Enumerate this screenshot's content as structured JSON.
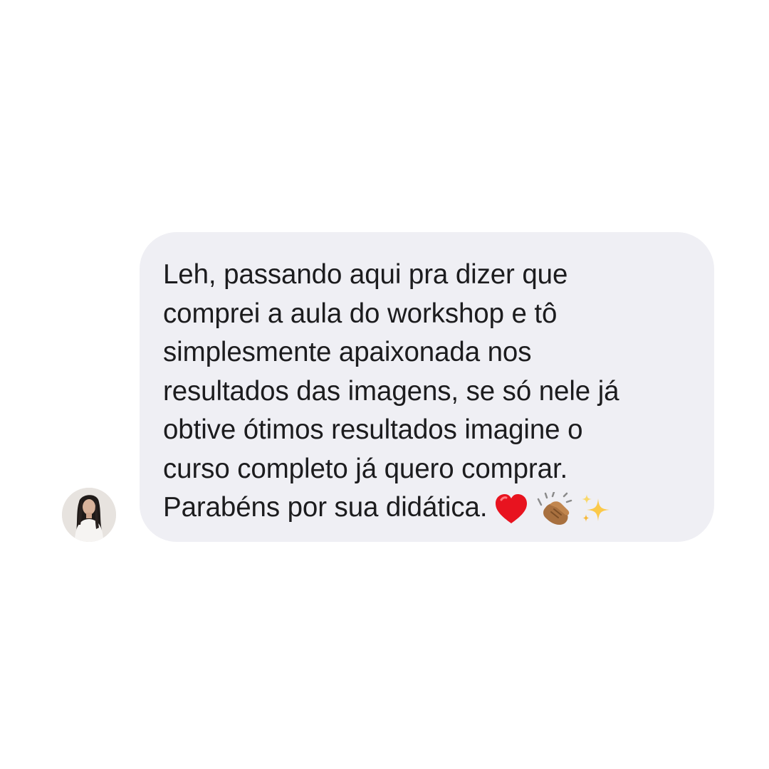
{
  "conversation": {
    "message": {
      "lines": [
        "Leh, passando aqui pra dizer que",
        "comprei a aula do workshop e tô",
        "simplesmente apaixonada nos",
        "resultados das imagens, se só nele já",
        "obtive ótimos resultados imagine o",
        "curso completo já quero comprar.",
        "Parabéns por sua didática."
      ],
      "emojis": [
        "red-heart-icon",
        "clapping-hands-icon",
        "sparkles-icon"
      ]
    },
    "sender": {
      "avatar_icon": "profile-photo"
    }
  },
  "colors": {
    "bubble_background": "#efeff4",
    "text": "#1c1c1e",
    "page_background": "#ffffff"
  }
}
